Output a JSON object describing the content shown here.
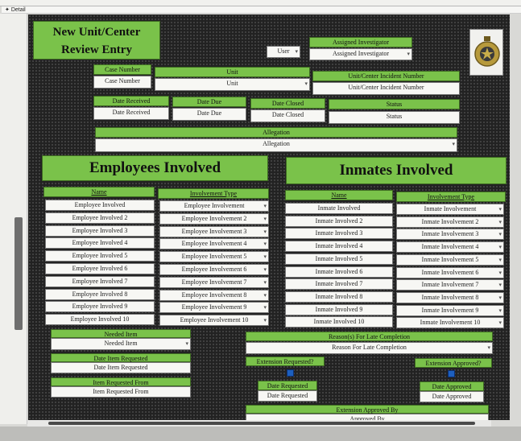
{
  "window": {
    "detail_label": "Detail"
  },
  "form": {
    "title_line1": "New Unit/Center",
    "title_line2": "Review Entry",
    "user_dropdown": "User",
    "assigned_investigator_label": "Assigned Investigator",
    "assigned_investigator_value": "Assigned Investigator",
    "case_number_label": "Case Number",
    "case_number_value": "Case Number",
    "unit_label": "Unit",
    "unit_value": "Unit",
    "incident_number_label": "Unit/Center Incident Number",
    "incident_number_value": "Unit/Center Incident Number",
    "date_received_label": "Date Received",
    "date_received_value": "Date Received",
    "date_due_label": "Date Due",
    "date_due_value": "Date Due",
    "date_closed_label": "Date Closed",
    "date_closed_value": "Date Closed",
    "status_label": "Status",
    "status_value": "Status",
    "allegation_label": "Allegation",
    "allegation_value": "Allegation"
  },
  "employees": {
    "heading": "Employees Involved",
    "name_header": "Name",
    "type_header": "Involvement Type",
    "names": [
      "Employee Involved",
      "Employee Involved 2",
      "Employee Involved 3",
      "Employee Involved 4",
      "Employee Involved 5",
      "Employee Involved 6",
      "Employee Involved 7",
      "Employee Involved 8",
      "Employee Involved 9",
      "Employee Involved 10"
    ],
    "types": [
      "Employee Involvement",
      "Employee Involvement 2",
      "Employee Involvement 3",
      "Employee Involvement 4",
      "Employee Involvement 5",
      "Employee Involvement 6",
      "Employee Involvement 7",
      "Employee Involvement 8",
      "Employee Involvement 9",
      "Employee Involvement 10"
    ]
  },
  "inmates": {
    "heading": "Inmates Involved",
    "name_header": "Name",
    "type_header": "Involvement Type",
    "names": [
      "Inmate Involved",
      "Inmate Involved 2",
      "Inmate Involved 3",
      "Inmate Involved 4",
      "Inmate Involved 5",
      "Inmate Involved 6",
      "Inmate Involved 7",
      "Inmate Involved 8",
      "Inmate Involved 9",
      "Inmate Involved 10"
    ],
    "types": [
      "Inmate Involvement",
      "Inmate Involvement 2",
      "Inmate Involvement 3",
      "Inmate Involvement 4",
      "Inmate Involvement 5",
      "Inmate Involvement 6",
      "Inmate Involvement 7",
      "Inmate Involvement 8",
      "Inmate Involvement 9",
      "Inmate Involvement 10"
    ]
  },
  "lower": {
    "needed_item_label": "Needed Item",
    "needed_item_value": "Needed Item",
    "date_item_requested_label": "Date Item Requested",
    "date_item_requested_value": "Date Item Requested",
    "item_requested_from_label": "Item Requested From",
    "item_requested_from_value": "Item Requested From",
    "reason_label": "Reason(s) For Late Completion",
    "reason_value": "Reason For Late Completion",
    "extension_requested_label": "Extension Requested?",
    "extension_approved_label": "Extension Approved?",
    "date_requested_label": "Date Requested",
    "date_requested_value": "Date Requested",
    "date_approved_label": "Date Approved",
    "date_approved_value": "Date Approved",
    "extension_approved_by_label": "Extension Approved By",
    "approved_by_value": "Approved By"
  },
  "colors": {
    "accent_green": "#7ac24a",
    "background": "#222222",
    "checkbox_blue": "#1d5fbf"
  }
}
